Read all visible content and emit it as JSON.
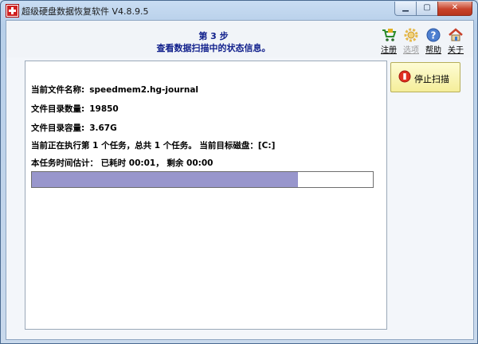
{
  "window": {
    "title": "超级硬盘数据恢复软件 V4.8.9.5",
    "controls": {
      "minimize": "▁",
      "restore": "▢",
      "close": "✕"
    }
  },
  "header": {
    "step": "第 3 步",
    "subtitle": "查看数据扫描中的状态信息。"
  },
  "toolbar": {
    "register": "注册",
    "options": "选项",
    "help": "帮助",
    "about": "关于"
  },
  "status": {
    "file_name_label": "当前文件名称:",
    "file_name_value": "speedmem2.hg-journal",
    "dir_count_label": "文件目录数量:",
    "dir_count_value": "19850",
    "dir_size_label": "文件目录容量:",
    "dir_size_value": "3.67G",
    "task_text": "当前正在执行第 1 个任务，总共 1 个任务。 当前目标磁盘：[C:]",
    "time_text": "本任务时间估计： 已耗时 00:01， 剩余 00:00",
    "progress_percent": 78
  },
  "actions": {
    "stop_scan": "停止扫描"
  },
  "colors": {
    "accent_text": "#11208c",
    "progress_fill": "#9896cc",
    "stop_button": "#f5ee9a"
  }
}
